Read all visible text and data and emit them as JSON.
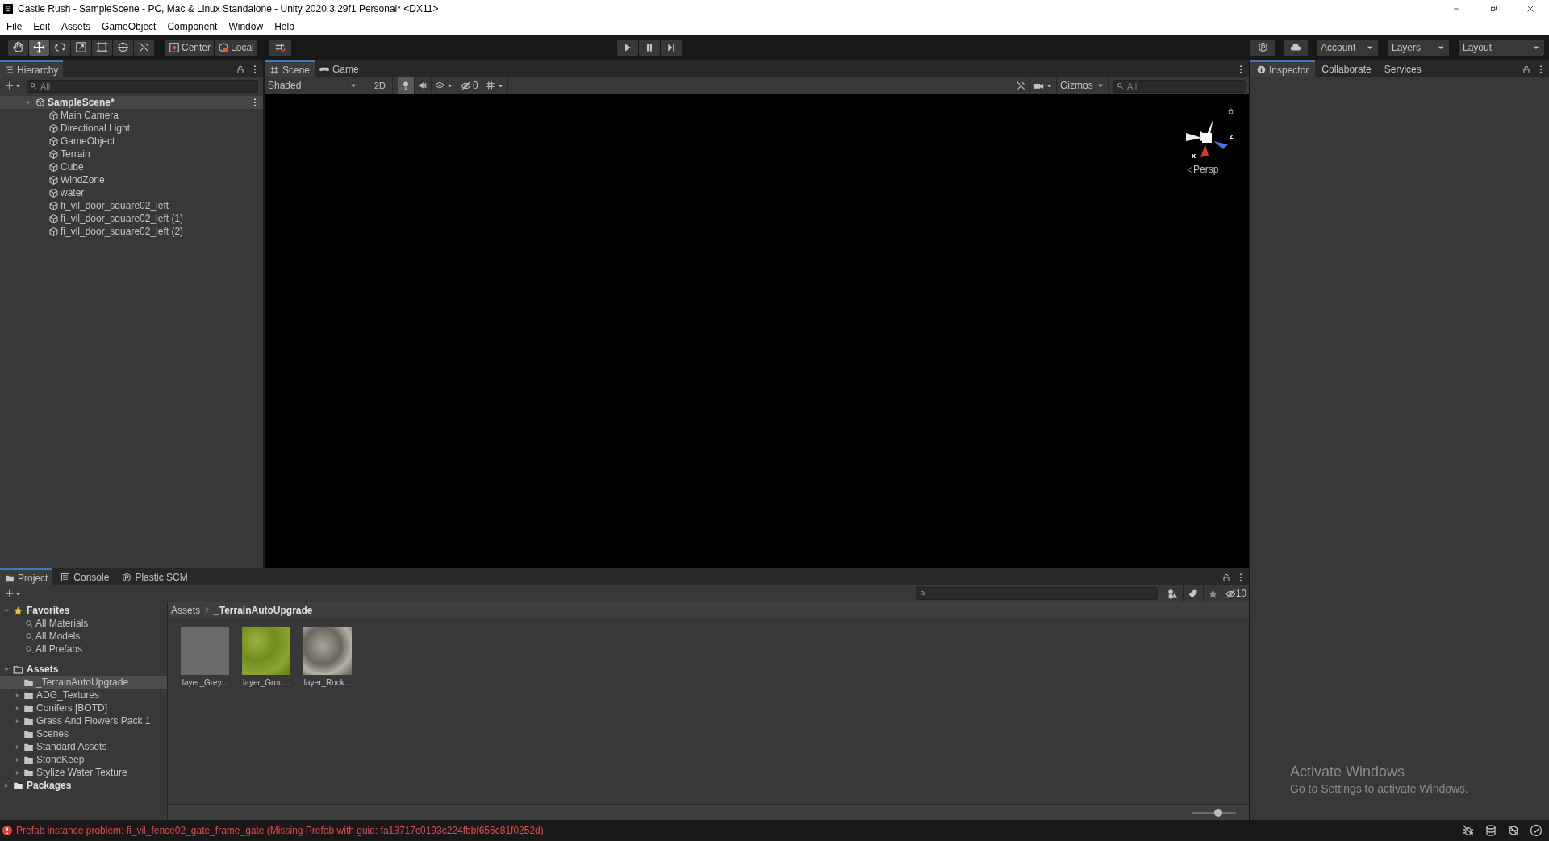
{
  "window": {
    "title": "Castle Rush - SampleScene - PC, Mac & Linux Standalone - Unity 2020.3.29f1 Personal* <DX11>"
  },
  "menu": [
    "File",
    "Edit",
    "Assets",
    "GameObject",
    "Component",
    "Window",
    "Help"
  ],
  "toolbar": {
    "tools": [
      {
        "kind": "hand",
        "selected": false
      },
      {
        "kind": "move",
        "selected": true
      },
      {
        "kind": "rotate",
        "selected": false
      },
      {
        "kind": "scale",
        "selected": false
      },
      {
        "kind": "rect",
        "selected": false
      },
      {
        "kind": "transform",
        "selected": false
      },
      {
        "kind": "custom",
        "selected": false
      }
    ],
    "pivot": [
      "Center",
      "Local"
    ],
    "dropdowns": [
      "Account",
      "Layers",
      "Layout"
    ]
  },
  "hierarchy": {
    "tab": "Hierarchy",
    "search_placeholder": "All",
    "scene": {
      "label": "SampleScene*",
      "expanded": true,
      "children": [
        "Main Camera",
        "Directional Light",
        "GameObject",
        "Terrain",
        "Cube",
        "WindZone",
        "water",
        "fi_vil_door_square02_left",
        "fi_vil_door_square02_left (1)",
        "fi_vil_door_square02_left (2)"
      ]
    }
  },
  "scene_view": {
    "tabs": [
      {
        "label": "Scene",
        "kind": "scene",
        "selected": true
      },
      {
        "label": "Game",
        "kind": "game",
        "selected": false
      }
    ],
    "toggles": [
      {
        "kind": "lighting",
        "on": true
      },
      {
        "kind": "audio",
        "on": false
      },
      {
        "kind": "effects",
        "on": false
      },
      {
        "kind": "grid",
        "on": false
      }
    ],
    "shading": "Shaded",
    "mode_2d": "2D",
    "hidden_count": "0",
    "gizmos": "Gizmos",
    "search_placeholder": "All",
    "axes": [
      "x",
      "z"
    ],
    "projection": "Persp"
  },
  "inspector": {
    "tabs": [
      {
        "label": "Inspector",
        "selected": true
      },
      {
        "label": "Collaborate",
        "selected": false
      },
      {
        "label": "Services",
        "selected": false
      }
    ]
  },
  "project": {
    "tabs": [
      {
        "label": "Project",
        "kind": "project",
        "selected": true
      },
      {
        "label": "Console",
        "kind": "console",
        "selected": false
      },
      {
        "label": "Plastic SCM",
        "kind": "plastic",
        "selected": false
      }
    ],
    "hidden_count": "10",
    "favorites": {
      "label": "Favorites",
      "expanded": true,
      "children": [
        "All Materials",
        "All Models",
        "All Prefabs"
      ]
    },
    "assets": {
      "label": "Assets",
      "expanded": true,
      "children": [
        {
          "label": "_TerrainAutoUpgrade",
          "expandable": false,
          "selected": true
        },
        {
          "label": "ADG_Textures",
          "expandable": true,
          "selected": false
        },
        {
          "label": "Conifers [BOTD]",
          "expandable": true,
          "selected": false
        },
        {
          "label": "Grass And Flowers Pack 1",
          "expandable": true,
          "selected": false
        },
        {
          "label": "Scenes",
          "expandable": false,
          "selected": false
        },
        {
          "label": "Standard Assets",
          "expandable": true,
          "selected": false
        },
        {
          "label": "StoneKeep",
          "expandable": true,
          "selected": false
        },
        {
          "label": "Stylize Water Texture",
          "expandable": true,
          "selected": false
        }
      ]
    },
    "packages": {
      "label": "Packages",
      "expanded": false
    },
    "breadcrumb": [
      "Assets",
      "_TerrainAutoUpgrade"
    ],
    "items": [
      {
        "label": "layer_Grey...",
        "kind": "grey"
      },
      {
        "label": "layer_Grou...",
        "kind": "grass"
      },
      {
        "label": "layer_Rock...",
        "kind": "rock"
      }
    ],
    "zoom": {
      "level": 0.6
    }
  },
  "status_bar": {
    "message": "Prefab instance problem: fi_vil_fence02_gate_frame_gate (Missing Prefab with guid: fa13717c0193c224fbbf656c81f0252d)"
  },
  "activation": {
    "title": "Activate Windows",
    "subtitle": "Go to Settings to activate Windows."
  }
}
